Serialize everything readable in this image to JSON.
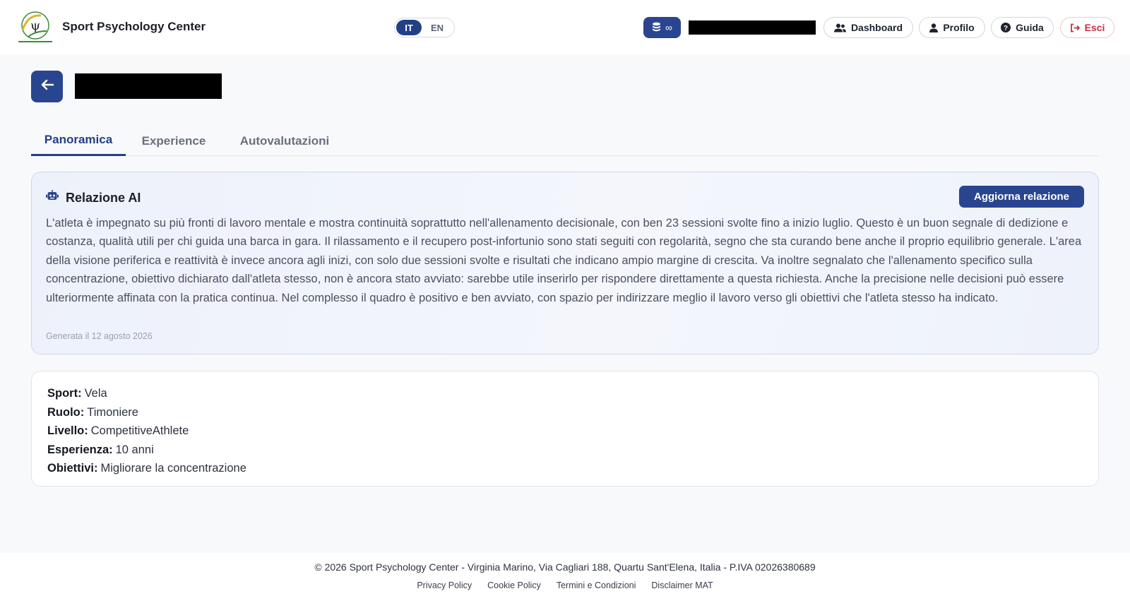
{
  "header": {
    "app_title": "Sport Psychology Center",
    "languages": [
      {
        "code": "IT",
        "active": true
      },
      {
        "code": "EN",
        "active": false
      }
    ],
    "credits_value": "∞",
    "nav": {
      "dashboard": "Dashboard",
      "profilo": "Profilo",
      "guida": "Guida",
      "esci": "Esci"
    }
  },
  "tabs": [
    {
      "label": "Panoramica",
      "active": true
    },
    {
      "label": "Experience",
      "active": false
    },
    {
      "label": "Autovalutazioni",
      "active": false
    }
  ],
  "ai_report": {
    "title": "Relazione AI",
    "refresh_label": "Aggiorna relazione",
    "text": "L'atleta è impegnato su più fronti di lavoro mentale e mostra continuità soprattutto nell'allenamento decisionale, con ben 23 sessioni svolte fino a inizio luglio. Questo è un buon segnale di dedizione e costanza, qualità utili per chi guida una barca in gara. Il rilassamento e il recupero post-infortunio sono stati seguiti con regolarità, segno che sta curando bene anche il proprio equilibrio generale. L'area della visione periferica e reattività è invece ancora agli inizi, con solo due sessioni svolte e risultati che indicano ampio margine di crescita. Va inoltre segnalato che l'allenamento specifico sulla concentrazione, obiettivo dichiarato dall'atleta stesso, non è ancora stato avviato: sarebbe utile inserirlo per rispondere direttamente a questa richiesta. Anche la precisione nelle decisioni può essere ulteriormente affinata con la pratica continua. Nel complesso il quadro è positivo e ben avviato, con spazio per indirizzare meglio il lavoro verso gli obiettivi che l'atleta stesso ha indicato.",
    "generated": "Generata il 12 agosto 2026"
  },
  "athlete": {
    "sport_label": "Sport:",
    "sport": "Vela",
    "ruolo_label": "Ruolo:",
    "ruolo": "Timoniere",
    "livello_label": "Livello:",
    "livello": "CompetitiveAthlete",
    "esperienza_label": "Esperienza:",
    "esperienza": "10 anni",
    "obiettivi_label": "Obiettivi:",
    "obiettivi": "Migliorare la concentrazione"
  },
  "footer": {
    "copyright": "© 2026 Sport Psychology Center - Virginia Marino, Via Cagliari 188, Quartu Sant'Elena, Italia - P.IVA 02026380689",
    "links": [
      "Privacy Policy",
      "Cookie Policy",
      "Termini e Condizioni",
      "Disclaimer MAT"
    ]
  },
  "colors": {
    "primary": "#2a4590",
    "danger": "#c9303f"
  }
}
